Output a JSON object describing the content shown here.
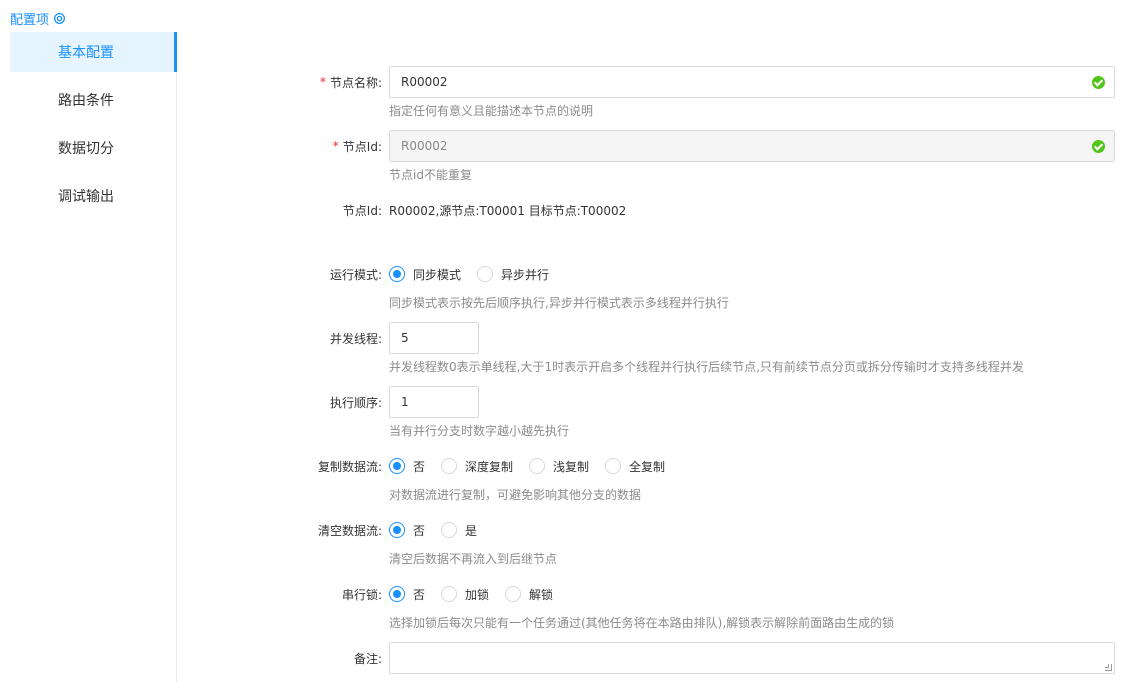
{
  "header": {
    "title": "配置项",
    "icon": "gear-icon"
  },
  "sidebar": {
    "items": [
      {
        "label": "基本配置",
        "active": true
      },
      {
        "label": "路由条件",
        "active": false
      },
      {
        "label": "数据切分",
        "active": false
      },
      {
        "label": "调试输出",
        "active": false
      }
    ]
  },
  "form": {
    "node_name": {
      "label": "节点名称:",
      "required": true,
      "value": "R00002",
      "help": "指定任何有意义且能描述本节点的说明"
    },
    "node_id": {
      "label": "节点Id:",
      "required": true,
      "value": "R00002",
      "help": "节点id不能重复"
    },
    "node_info": {
      "label": "节点Id:",
      "value": "R00002,源节点:T00001 目标节点:T00002"
    },
    "run_mode": {
      "label": "运行模式:",
      "options": [
        "同步模式",
        "异步并行"
      ],
      "selected": "同步模式",
      "help": "同步模式表示按先后顺序执行,异步并行模式表示多线程并行执行"
    },
    "concurrency": {
      "label": "并发线程:",
      "value": "5",
      "help": "并发线程数0表示单线程,大于1时表示开启多个线程并行执行后续节点,只有前续节点分页或拆分传输时才支持多线程并发"
    },
    "exec_order": {
      "label": "执行顺序:",
      "value": "1",
      "help": "当有并行分支时数字越小越先执行"
    },
    "copy_stream": {
      "label": "复制数据流:",
      "options": [
        "否",
        "深度复制",
        "浅复制",
        "全复制"
      ],
      "selected": "否",
      "help": "对数据流进行复制，可避免影响其他分支的数据"
    },
    "clear_stream": {
      "label": "清空数据流:",
      "options": [
        "否",
        "是"
      ],
      "selected": "否",
      "help": "清空后数据不再流入到后继节点"
    },
    "serial_lock": {
      "label": "串行锁:",
      "options": [
        "否",
        "加锁",
        "解锁"
      ],
      "selected": "否",
      "help": "选择加锁后每次只能有一个任务通过(其他任务将在本路由排队),解锁表示解除前面路由生成的锁"
    },
    "remark": {
      "label": "备注:",
      "value": ""
    }
  },
  "colors": {
    "accent": "#1890ff",
    "success": "#52c41a",
    "required": "#f5222d"
  }
}
